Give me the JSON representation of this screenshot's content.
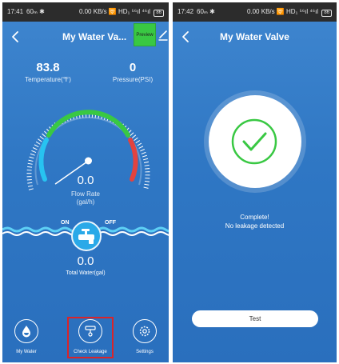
{
  "colors": {
    "background": "#2f77c4",
    "accent_green": "#39c843",
    "highlight_red": "#d9242a",
    "gauge_blue": "#27c3f1",
    "gauge_green": "#39c843",
    "gauge_red": "#e2433f"
  },
  "left_screen": {
    "status_bar": {
      "time": "17:41",
      "extras": "60ₘ ✱",
      "right": "0.00 KB/s 🛜 HD₁ ⁵⁶ıl ⁴⁶ıl",
      "battery": "86"
    },
    "header": {
      "back_icon": "chevron-left-icon",
      "title": "My Water Va...",
      "preview_label": "Preview",
      "edit_icon": "pencil-icon"
    },
    "readings": {
      "temperature": {
        "value": "83.8",
        "label": "Temperature(℉)"
      },
      "pressure": {
        "value": "0",
        "label": "Pressure(PSI)"
      }
    },
    "gauge": {
      "value": "0.0",
      "label_line1": "Flow Rate",
      "label_line2": "(gal/h)",
      "needle_fraction": 0.0
    },
    "valve": {
      "on_label": "ON",
      "off_label": "OFF",
      "icon": "valve-icon"
    },
    "total": {
      "value": "0.0",
      "label": "Total Water(gal)"
    },
    "bottom_nav": [
      {
        "label": "My Water",
        "icon": "water-drop-icon"
      },
      {
        "label": "Check Leakage",
        "icon": "leak-check-icon"
      },
      {
        "label": "Settings",
        "icon": "gear-icon"
      }
    ]
  },
  "right_screen": {
    "status_bar": {
      "time": "17:42",
      "extras": "60ₘ ✱",
      "right": "0.00 KB/s 🛜 HD₁ ⁵⁶ıl ⁴⁶ıl",
      "battery": "86"
    },
    "header": {
      "back_icon": "chevron-left-icon",
      "title": "My Water Valve"
    },
    "result": {
      "icon": "check-circle-icon",
      "title": "Complete!",
      "message": "No leakage detected"
    },
    "test_button": "Test"
  }
}
